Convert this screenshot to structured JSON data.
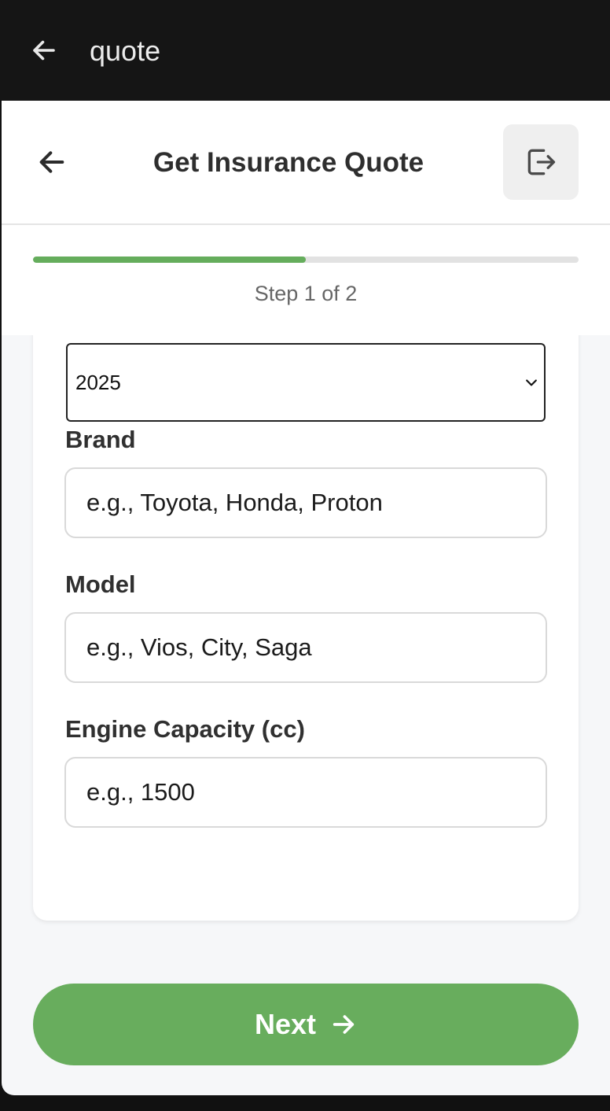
{
  "browser": {
    "title": "quote"
  },
  "header": {
    "title": "Get Insurance Quote"
  },
  "progress": {
    "fraction": 0.5,
    "step_text": "Step 1 of 2"
  },
  "form": {
    "year": {
      "selected": "2025"
    },
    "brand": {
      "label": "Brand",
      "placeholder": "e.g., Toyota, Honda, Proton"
    },
    "model": {
      "label": "Model",
      "placeholder": "e.g., Vios, City, Saga"
    },
    "engine": {
      "label": "Engine Capacity (cc)",
      "placeholder": "e.g., 1500"
    }
  },
  "actions": {
    "next_label": "Next"
  },
  "colors": {
    "accent": "#68ad5d",
    "topbar": "#151515"
  },
  "icons": {
    "back": "arrow-left-icon",
    "logout": "logout-icon",
    "chevron": "chevron-down-icon",
    "next": "arrow-right-icon"
  }
}
